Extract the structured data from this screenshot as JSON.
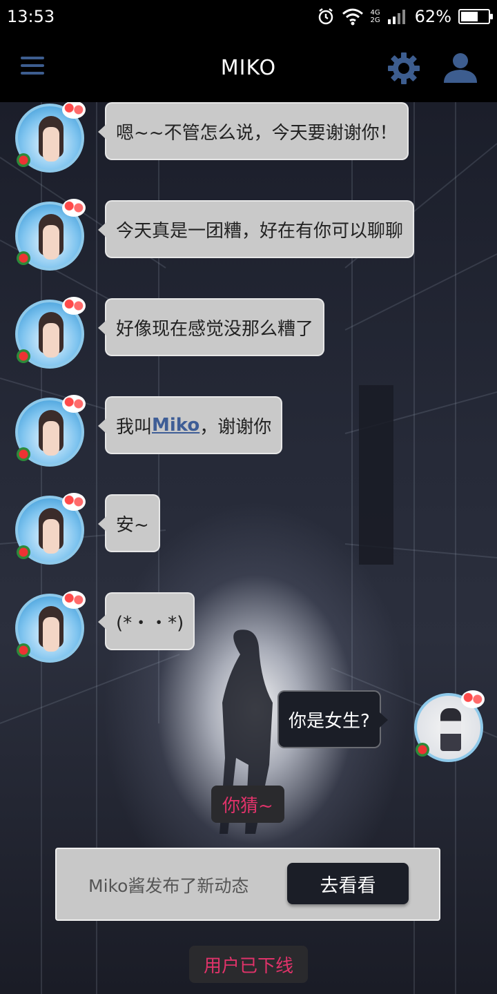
{
  "status_bar": {
    "time": "13:53",
    "net_top": "4G",
    "net_bottom": "2G",
    "battery_pct": "62%",
    "battery_level": 0.62,
    "icons": [
      "alarm-icon",
      "wifi-icon",
      "signal-icon",
      "battery-icon"
    ]
  },
  "app_bar": {
    "title": "MIKO",
    "icons": [
      "menu-icon",
      "gear-icon",
      "user-icon"
    ],
    "accent": "#3d5d8f"
  },
  "messages": [
    {
      "side": "left",
      "text": "嗯~~不管怎么说，今天要谢谢你！"
    },
    {
      "side": "left",
      "text": "今天真是一团糟，好在有你可以聊聊"
    },
    {
      "side": "left",
      "text": "好像现在感觉没那么糟了"
    },
    {
      "side": "left",
      "prefix": "我叫",
      "link": "Miko",
      "suffix": "，谢谢你"
    },
    {
      "side": "left",
      "text": "安~"
    },
    {
      "side": "left",
      "text": "(*・・*)"
    },
    {
      "side": "right",
      "text": "你是女生?"
    }
  ],
  "reply_option": "你猜~",
  "notice": {
    "text": "Miko酱发布了新动态",
    "button": "去看看"
  },
  "offline_status": "用户已下线",
  "colors": {
    "bubble_left": "#c9c9c9",
    "bubble_right": "#1b1e27",
    "alert_text": "#e0336a"
  }
}
